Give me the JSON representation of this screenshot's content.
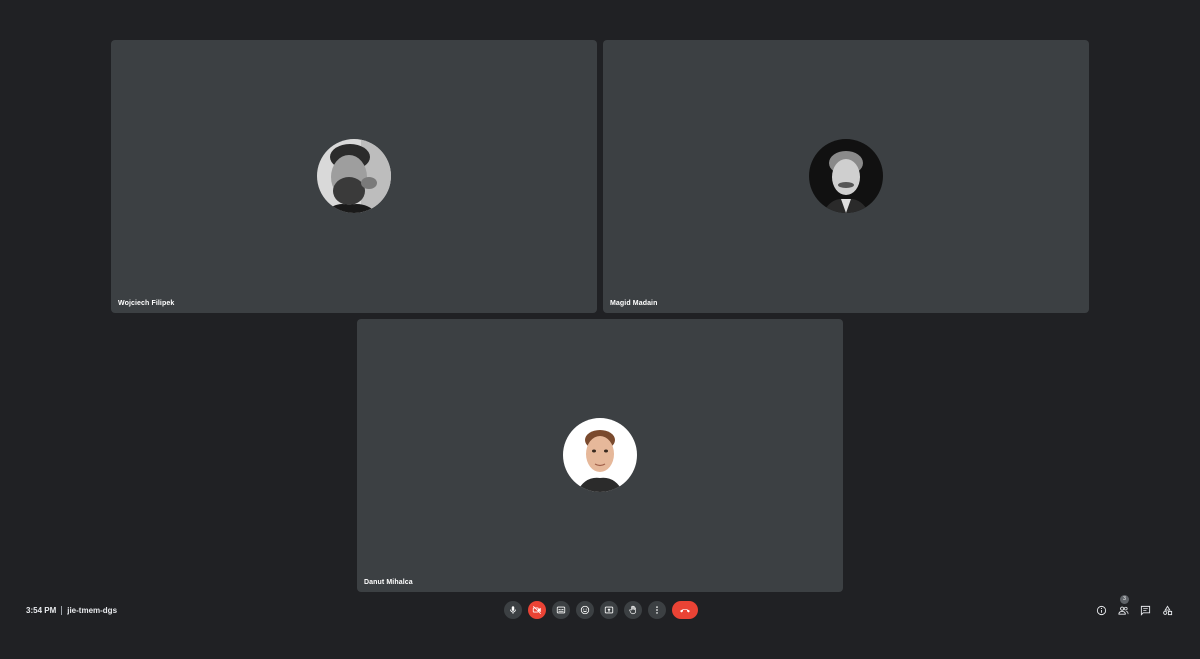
{
  "participants": [
    {
      "name": "Wojciech Filipek"
    },
    {
      "name": "Magid Madain"
    },
    {
      "name": "Danut Mihalca"
    }
  ],
  "meeting": {
    "time": "3:54 PM",
    "code": "jie-tmem-dgs"
  },
  "controls": {
    "icons": [
      "microphone-icon",
      "camera-off-icon",
      "captions-icon",
      "emoji-icon",
      "present-screen-icon",
      "raise-hand-icon",
      "more-options-icon",
      "hang-up-icon"
    ]
  },
  "side_panel": {
    "icons": [
      "info-icon",
      "people-icon",
      "chat-icon",
      "activities-icon"
    ],
    "people_count": "3"
  },
  "colors": {
    "background": "#202124",
    "tile": "#3c4043",
    "danger": "#ea4335"
  }
}
